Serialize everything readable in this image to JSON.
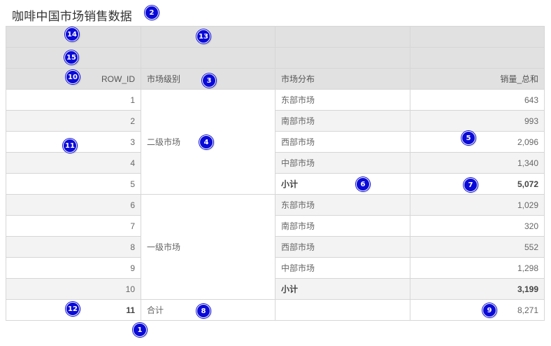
{
  "title": "咖啡中国市场销售数据",
  "columns": {
    "row_id": "ROW_ID",
    "level": "市场级别",
    "region": "市场分布",
    "sales": "销量_总和"
  },
  "rows": [
    {
      "id": "1",
      "region": "东部市场",
      "sales": "643"
    },
    {
      "id": "2",
      "region": "南部市场",
      "sales": "993"
    },
    {
      "id": "3",
      "region": "西部市场",
      "sales": "2,096"
    },
    {
      "id": "4",
      "region": "中部市场",
      "sales": "1,340"
    },
    {
      "id": "5",
      "region": "小计",
      "sales": "5,072"
    },
    {
      "id": "6",
      "region": "东部市场",
      "sales": "1,029"
    },
    {
      "id": "7",
      "region": "南部市场",
      "sales": "320"
    },
    {
      "id": "8",
      "region": "西部市场",
      "sales": "552"
    },
    {
      "id": "9",
      "region": "中部市场",
      "sales": "1,298"
    },
    {
      "id": "10",
      "region": "小计",
      "sales": "3,199"
    }
  ],
  "groups": [
    "二级市场",
    "一级市场"
  ],
  "total": {
    "id": "11",
    "label": "合计",
    "sales": "8,271"
  },
  "badges": [
    "1",
    "2",
    "3",
    "4",
    "5",
    "6",
    "7",
    "8",
    "9",
    "10",
    "11",
    "12",
    "13",
    "14",
    "15"
  ]
}
